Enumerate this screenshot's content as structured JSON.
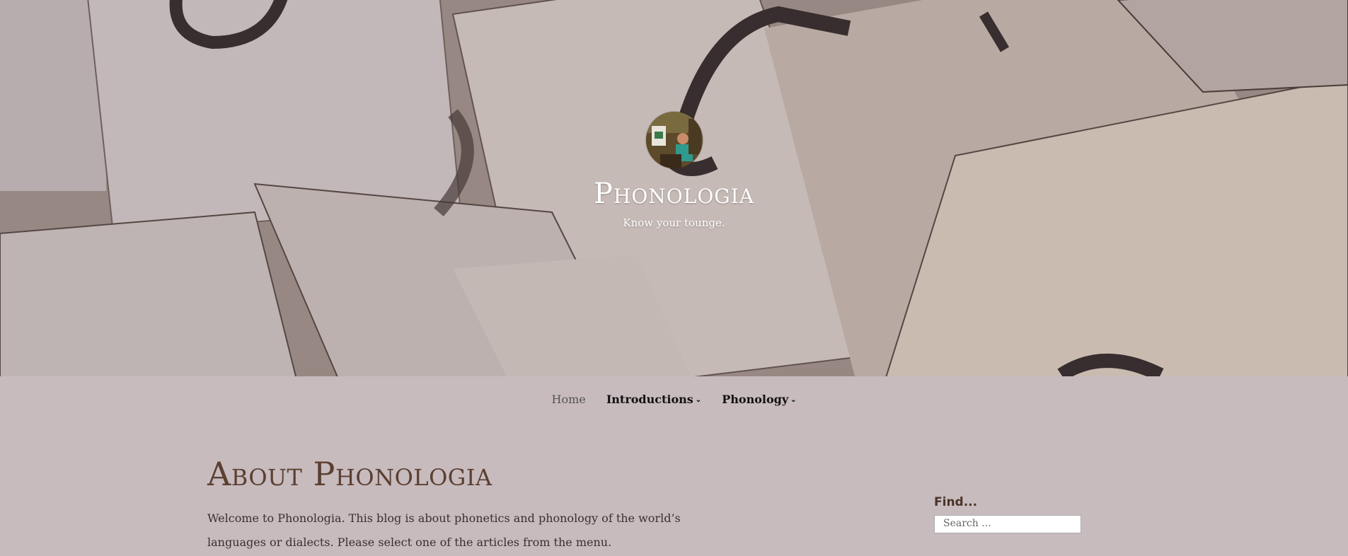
{
  "header": {
    "site_title": "Phonologia",
    "tagline": "Know your tounge."
  },
  "nav": {
    "items": [
      {
        "label": "Home"
      },
      {
        "label": "Introductions"
      },
      {
        "label": "Phonology"
      }
    ]
  },
  "main": {
    "title": "About Phonologia",
    "paragraph_line1": "Welcome to Phonologia. This blog is about phonetics and phonology of the world’s",
    "paragraph_line2": "languages or dialects. Please select one of the articles from the menu."
  },
  "sidebar": {
    "find_title": "Find...",
    "search_placeholder": "Search ..."
  },
  "colors": {
    "background": "#c7bbbe",
    "title": "#5b3f30"
  },
  "icons": {
    "dropdown": "chevron-down-icon"
  }
}
